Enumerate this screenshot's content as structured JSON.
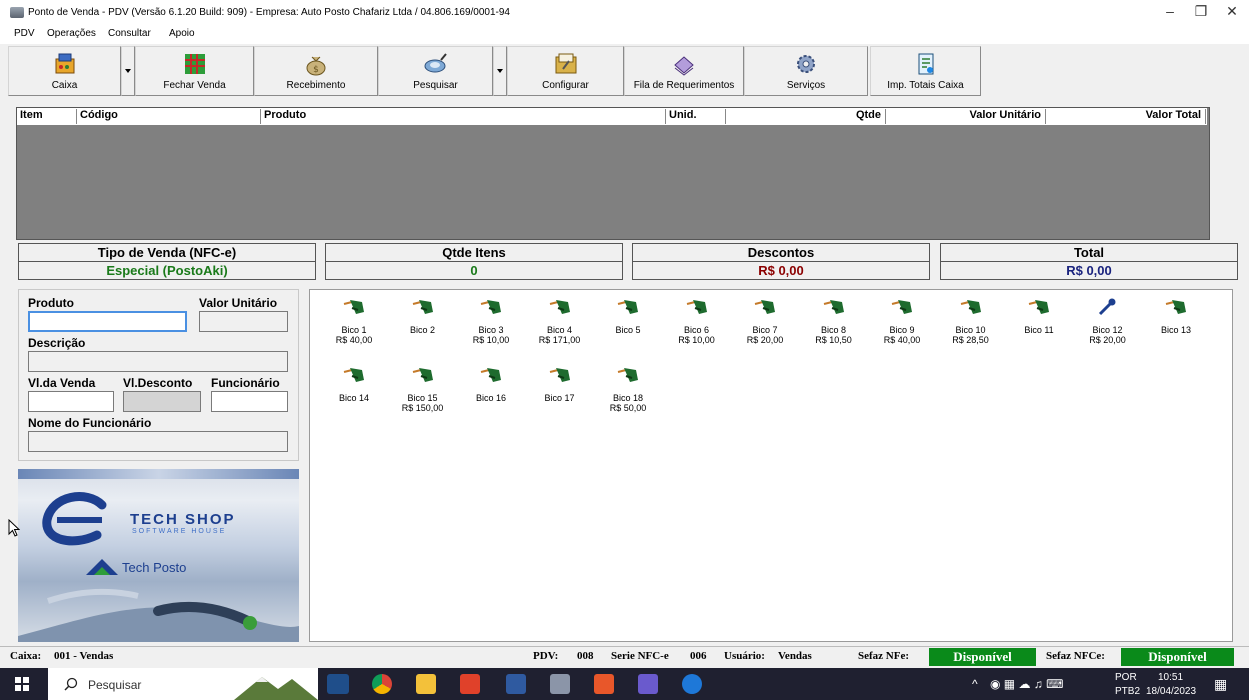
{
  "window": {
    "title": "Ponto de Venda - PDV (Versão 6.1.20 Build: 909) - Empresa: Auto Posto Chafariz Ltda / 04.806.169/0001-94"
  },
  "menu": [
    "PDV",
    "Operações",
    "Consultar",
    "Apoio"
  ],
  "toolbar": {
    "caixa": "Caixa",
    "fechar_venda": "Fechar Venda",
    "recebimento": "Recebimento",
    "pesquisar": "Pesquisar",
    "configurar": "Configurar",
    "fila": "Fila de Requerimentos",
    "servicos": "Serviços",
    "imp_totais": "Imp. Totais Caixa"
  },
  "grid": {
    "columns": [
      "Item",
      "Código",
      "Produto",
      "Unid.",
      "Qtde",
      "Valor Unitário",
      "Valor Total"
    ]
  },
  "summary": {
    "tipo_venda_label": "Tipo de Venda (NFC-e)",
    "tipo_venda_value": "Especial (PostoAki)",
    "qtde_itens_label": "Qtde Itens",
    "qtde_itens_value": "0",
    "descontos_label": "Descontos",
    "descontos_value": "R$ 0,00",
    "total_label": "Total",
    "total_value": "R$ 0,00"
  },
  "form": {
    "produto": "Produto",
    "valor_unitario": "Valor Unitário",
    "descricao": "Descrição",
    "vl_venda": "Vl.da Venda",
    "vl_desconto": "Vl.Desconto",
    "funcionario": "Funcionário",
    "nome_funcionario": "Nome do Funcionário"
  },
  "logo": {
    "brand": "TECH SHOP",
    "tagline": "SOFTWARE HOUSE",
    "product": "Tech Posto"
  },
  "bicos": [
    {
      "name": "Bico 1",
      "price": "R$ 40,00"
    },
    {
      "name": "Bico 2",
      "price": ""
    },
    {
      "name": "Bico 3",
      "price": "R$ 10,00"
    },
    {
      "name": "Bico 4",
      "price": "R$ 171,00"
    },
    {
      "name": "Bico 5",
      "price": ""
    },
    {
      "name": "Bico 6",
      "price": "R$ 10,00"
    },
    {
      "name": "Bico 7",
      "price": "R$ 20,00"
    },
    {
      "name": "Bico 8",
      "price": "R$ 10,50"
    },
    {
      "name": "Bico 9",
      "price": "R$ 40,00"
    },
    {
      "name": "Bico 10",
      "price": "R$ 28,50"
    },
    {
      "name": "Bico 11",
      "price": ""
    },
    {
      "name": "Bico 12",
      "price": "R$ 20,00"
    },
    {
      "name": "Bico 13",
      "price": ""
    },
    {
      "name": "Bico 14",
      "price": ""
    },
    {
      "name": "Bico 15",
      "price": "R$ 150,00"
    },
    {
      "name": "Bico 16",
      "price": ""
    },
    {
      "name": "Bico 17",
      "price": ""
    },
    {
      "name": "Bico 18",
      "price": "R$ 50,00"
    }
  ],
  "status": {
    "caixa_label": "Caixa:",
    "caixa_value": "001 - Vendas",
    "pdv_label": "PDV:",
    "pdv_value": "008",
    "serie_label": "Serie NFC-e",
    "serie_value": "006",
    "usuario_label": "Usuário:",
    "usuario_value": "Vendas",
    "sefaz_nfe_label": "Sefaz NFe:",
    "sefaz_nfe_value": "Disponível",
    "sefaz_nfce_label": "Sefaz NFCe:",
    "sefaz_nfce_value": "Disponível"
  },
  "taskbar": {
    "search_placeholder": "Pesquisar",
    "lang_line1": "POR",
    "lang_line2": "PTB2",
    "time": "10:51",
    "date": "18/04/2023"
  },
  "colors": {
    "green_status": "#0a8a1a",
    "tipo_venda_text": "#1a7a1a",
    "qtde_text": "#1a7a1a",
    "descontos_text": "#8b0000",
    "total_text": "#1a237e"
  }
}
